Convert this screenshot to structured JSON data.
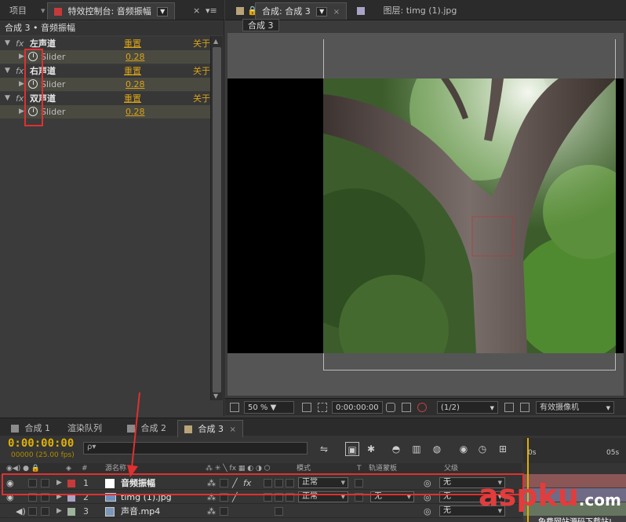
{
  "left_tabs": {
    "project": "项目",
    "effect_controls": "特效控制台: 音频振幅"
  },
  "effect_controls": {
    "header": "合成 3 • 音频振幅",
    "fx_label": "fx",
    "param_name": "Slider",
    "effects": [
      {
        "name": "左声道",
        "reset": "重置",
        "about": "关于",
        "value": "0.28"
      },
      {
        "name": "右声道",
        "reset": "重置",
        "about": "关于",
        "value": "0.28"
      },
      {
        "name": "双声道",
        "reset": "重置",
        "about": "关于",
        "value": "0.28"
      }
    ]
  },
  "viewer_tabs": {
    "comp": "合成: 合成 3",
    "layer": "图层: timg (1).jpg",
    "breadcrumb": "合成 3"
  },
  "viewer_toolbar": {
    "zoom": "50 %",
    "timecode": "0:00:00:00",
    "resolution": "(1/2)",
    "camera": "有效摄像机"
  },
  "timeline": {
    "tabs": [
      "合成 1",
      "渲染队列",
      "合成 2",
      "合成 3"
    ],
    "current_time": "0:00:00:00",
    "fps": "00000 (25.00 fps)",
    "search_placeholder": "ρ▾",
    "columns": {
      "num": "#",
      "source": "源名称",
      "mode": "模式",
      "t": "T",
      "trkmat": "轨道蒙板",
      "parent": "父级"
    },
    "ruler_labels": [
      "0s",
      "05s"
    ],
    "layers": [
      {
        "num": "1",
        "name": "音频振幅",
        "mode": "正常",
        "trkmat": "",
        "parent": "无",
        "color": "#c73a3a"
      },
      {
        "num": "2",
        "name": "timg (1).jpg",
        "mode": "正常",
        "trkmat": "无",
        "parent": "无",
        "color": "#a9a4c6"
      },
      {
        "num": "3",
        "name": "声音.mp4",
        "mode": "",
        "trkmat": "",
        "parent": "无",
        "color": "#9fb39c"
      }
    ]
  },
  "watermark": {
    "brand": "aspku",
    "tld": ".com",
    "sub": "免费网站源码下载站!"
  },
  "colors": {
    "accent": "#d9a31a",
    "highlight_red": "#e03030",
    "timecode": "#e0b000"
  }
}
